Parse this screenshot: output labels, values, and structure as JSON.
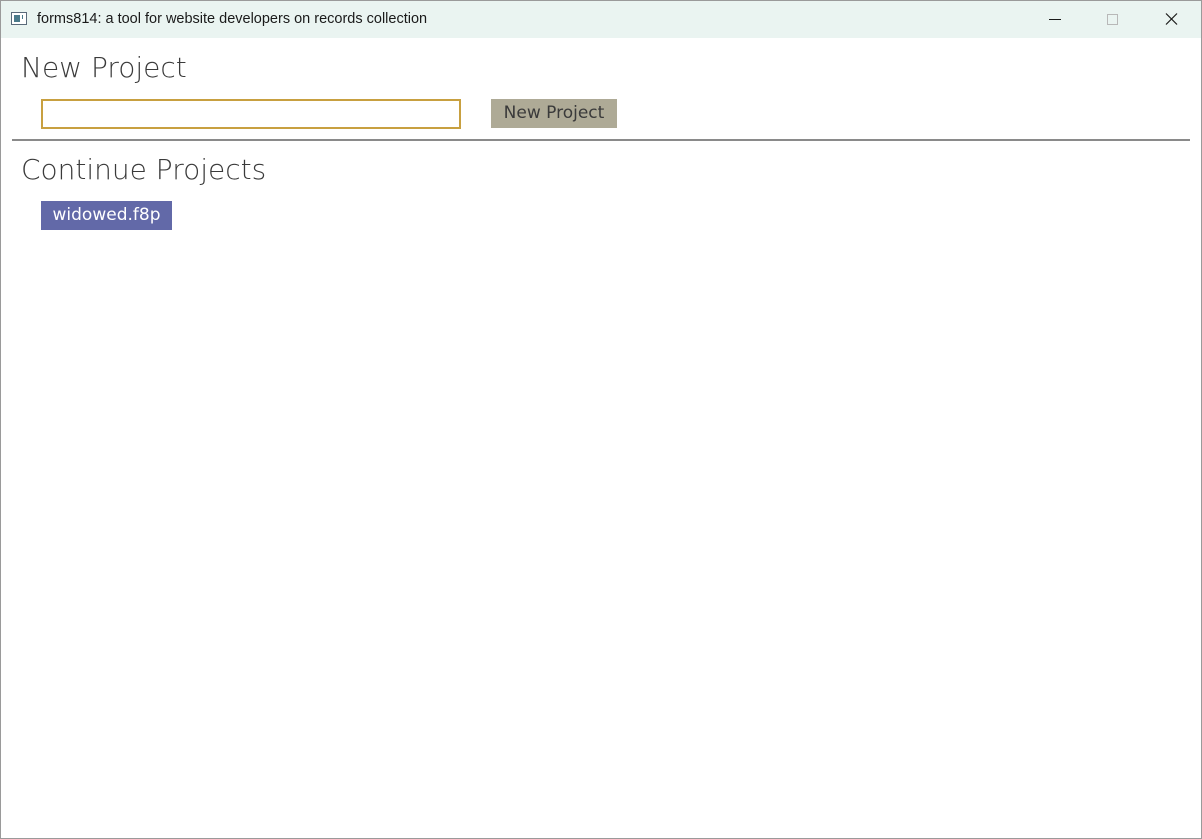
{
  "window": {
    "title": "forms814: a tool for website developers on records collection",
    "icon": "app-window-icon",
    "controls": {
      "minimize_icon": "minimize-icon",
      "maximize_icon": "maximize-icon",
      "close_icon": "close-icon"
    }
  },
  "new_project": {
    "heading": "New Project",
    "input_value": "",
    "input_placeholder": "",
    "button_label": "New Project"
  },
  "continue_projects": {
    "heading": "Continue Projects",
    "items": [
      {
        "label": "widowed.f8p"
      }
    ]
  },
  "colors": {
    "titlebar_bg": "#eaf4f1",
    "input_border": "#c8a040",
    "button_bg": "#aeaa96",
    "project_item_bg": "#6269a8",
    "divider": "#8a8a8a"
  }
}
